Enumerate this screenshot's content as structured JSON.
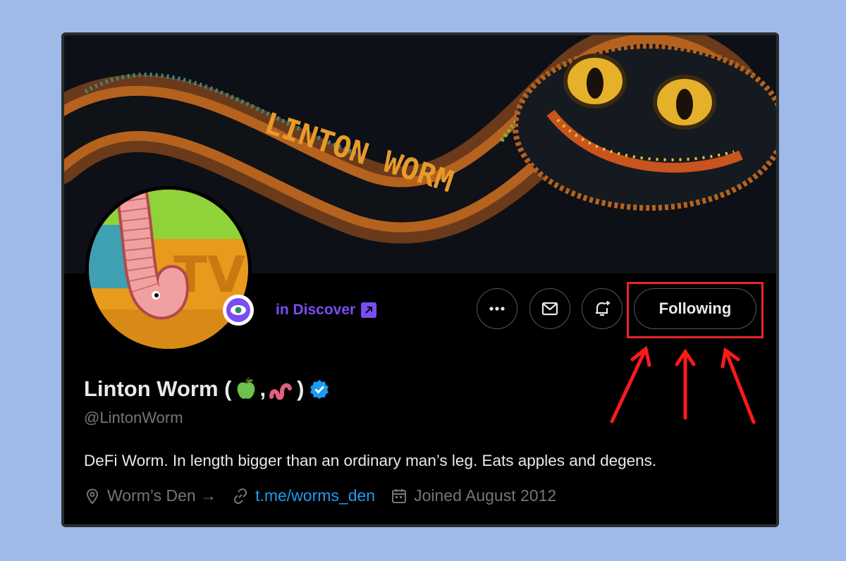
{
  "banner": {
    "text": "LINTON WORM"
  },
  "discover": {
    "label": "in Discover"
  },
  "actions": {
    "more_label": "···",
    "following_label": "Following"
  },
  "profile": {
    "name": "Linton Worm (",
    "name_sep": ",",
    "name_close": ")",
    "handle": "@LintonWorm",
    "bio": "DeFi Worm. In length bigger than an ordinary man’s leg. Eats apples and degens.",
    "location": "Worm’s Den →",
    "website": "t.me/worms_den",
    "joined": "Joined August 2012"
  },
  "icons": {
    "more": "more-icon",
    "message": "mail-icon",
    "notify": "bell-plus-icon",
    "verified": "verified-badge-icon",
    "location": "location-pin-icon",
    "link": "link-icon",
    "calendar": "calendar-icon",
    "discover": "eye-icon",
    "external": "external-link-icon"
  },
  "colors": {
    "background": "#9fb9e9",
    "accent_link": "#1d9bf0",
    "discover_purple": "#7b4cf4",
    "highlight_red": "#e8252b",
    "muted_text": "#71767b"
  }
}
